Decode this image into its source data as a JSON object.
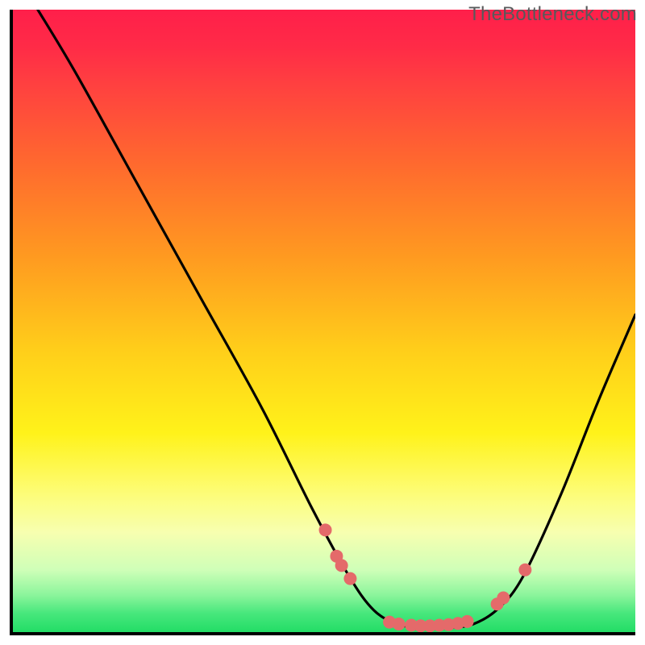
{
  "watermark": "TheBottleneck.com",
  "chart_data": {
    "type": "line",
    "title": "",
    "xlabel": "",
    "ylabel": "",
    "xlim": [
      0,
      100
    ],
    "ylim": [
      0,
      100
    ],
    "gradient_stops": [
      {
        "pos": 0,
        "color": "#ff1f4a"
      },
      {
        "pos": 6,
        "color": "#ff2b47"
      },
      {
        "pos": 12,
        "color": "#ff4040"
      },
      {
        "pos": 25,
        "color": "#ff6a2e"
      },
      {
        "pos": 40,
        "color": "#ff9b20"
      },
      {
        "pos": 55,
        "color": "#ffcf1a"
      },
      {
        "pos": 68,
        "color": "#fff21a"
      },
      {
        "pos": 78,
        "color": "#fdfd7a"
      },
      {
        "pos": 84,
        "color": "#f7ffb0"
      },
      {
        "pos": 90,
        "color": "#cfffb8"
      },
      {
        "pos": 94,
        "color": "#8cf59c"
      },
      {
        "pos": 97,
        "color": "#47e77c"
      },
      {
        "pos": 100,
        "color": "#23dd66"
      }
    ],
    "series": [
      {
        "name": "curve",
        "color": "#000000",
        "points": [
          {
            "x": 4.0,
            "y": 100.0
          },
          {
            "x": 10.0,
            "y": 90.0
          },
          {
            "x": 20.0,
            "y": 72.0
          },
          {
            "x": 30.0,
            "y": 54.0
          },
          {
            "x": 40.0,
            "y": 36.0
          },
          {
            "x": 48.0,
            "y": 20.0
          },
          {
            "x": 54.0,
            "y": 9.0
          },
          {
            "x": 58.0,
            "y": 3.5
          },
          {
            "x": 62.0,
            "y": 1.2
          },
          {
            "x": 66.0,
            "y": 0.7
          },
          {
            "x": 70.0,
            "y": 0.7
          },
          {
            "x": 74.0,
            "y": 1.3
          },
          {
            "x": 78.0,
            "y": 3.8
          },
          {
            "x": 82.0,
            "y": 9.0
          },
          {
            "x": 88.0,
            "y": 22.0
          },
          {
            "x": 94.0,
            "y": 37.0
          },
          {
            "x": 100.0,
            "y": 51.0
          }
        ]
      }
    ],
    "markers": {
      "color": "#e46a6a",
      "radius_px": 8,
      "points": [
        {
          "x": 50.2,
          "y": 16.4
        },
        {
          "x": 52.0,
          "y": 12.2
        },
        {
          "x": 52.8,
          "y": 10.7
        },
        {
          "x": 54.2,
          "y": 8.6
        },
        {
          "x": 60.5,
          "y": 1.6
        },
        {
          "x": 62.0,
          "y": 1.3
        },
        {
          "x": 64.0,
          "y": 1.1
        },
        {
          "x": 65.5,
          "y": 1.0
        },
        {
          "x": 67.0,
          "y": 1.0
        },
        {
          "x": 68.5,
          "y": 1.1
        },
        {
          "x": 70.0,
          "y": 1.2
        },
        {
          "x": 71.5,
          "y": 1.4
        },
        {
          "x": 73.0,
          "y": 1.7
        },
        {
          "x": 77.8,
          "y": 4.5
        },
        {
          "x": 78.8,
          "y": 5.5
        },
        {
          "x": 82.3,
          "y": 10.0
        }
      ]
    }
  }
}
